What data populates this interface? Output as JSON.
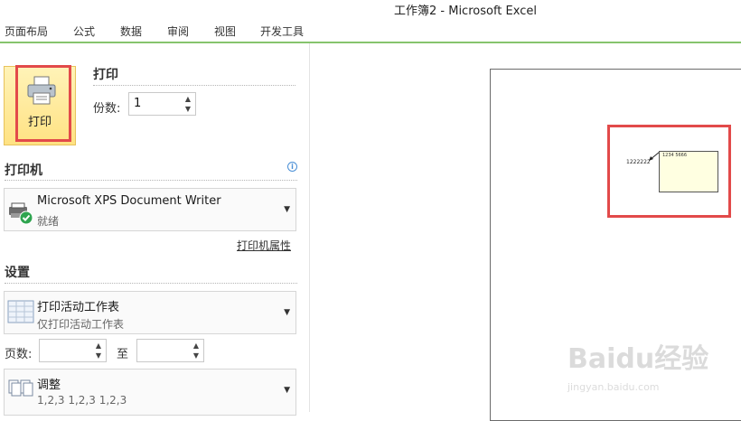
{
  "window": {
    "title": "工作簿2  -  Microsoft Excel"
  },
  "ribbon": {
    "tabs": [
      "页面布局",
      "公式",
      "数据",
      "审阅",
      "视图",
      "开发工具"
    ]
  },
  "print": {
    "button_label": "打印",
    "section_title": "打印",
    "copies_label": "份数:",
    "copies_value": "1"
  },
  "printer": {
    "section_title": "打印机",
    "name": "Microsoft XPS Document Writer",
    "status": "就绪",
    "properties_link": "打印机属性"
  },
  "settings": {
    "section_title": "设置",
    "scope_main": "打印活动工作表",
    "scope_sub": "仅打印活动工作表",
    "pages_label": "页数:",
    "pages_to": "至",
    "pages_from_value": "",
    "pages_to_value": "",
    "collate_main": "调整",
    "collate_sub": "1,2,3    1,2,3    1,2,3"
  },
  "preview": {
    "cell_text": "1222222",
    "comment_text": "1234 5666"
  },
  "watermark": {
    "brand": "Baidu经验",
    "url": "jingyan.baidu.com"
  },
  "colors": {
    "accent_red": "#e24a4a",
    "ribbon_green": "#86c46d",
    "print_button": "#ffe283"
  }
}
